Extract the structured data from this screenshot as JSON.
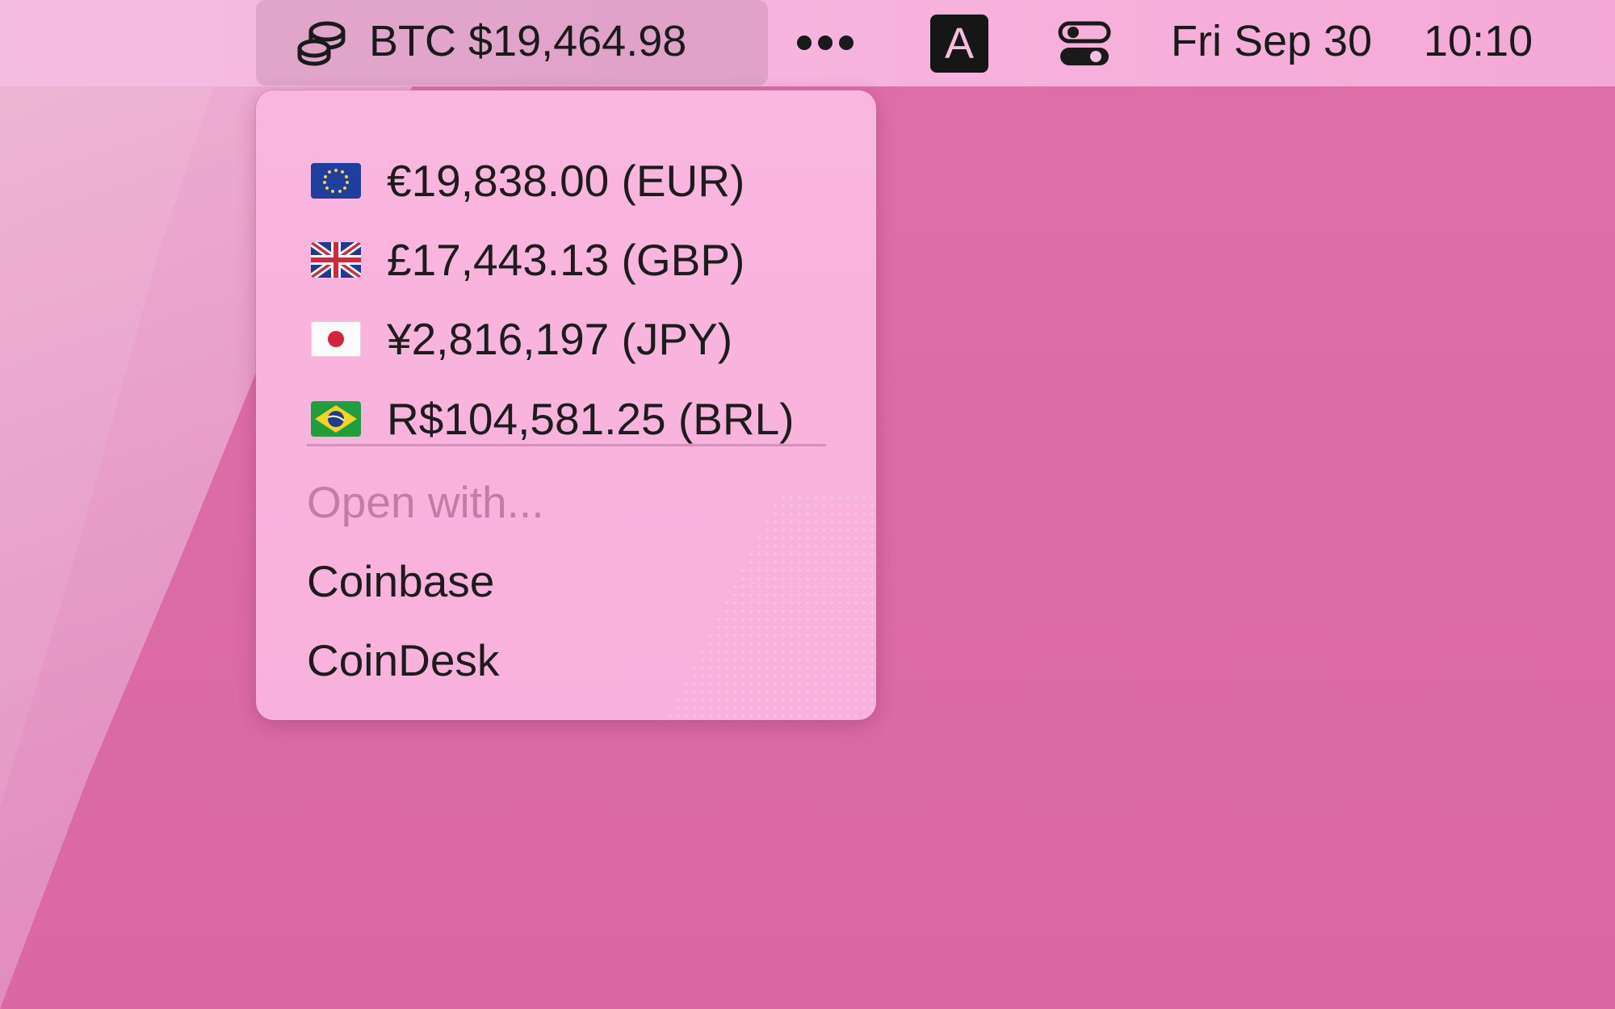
{
  "menubar": {
    "btc_label": "BTC $19,464.98",
    "input_source_label": "A",
    "date": "Fri Sep 30",
    "time": "10:10",
    "icons": {
      "btc": "coins-icon",
      "more": "ellipsis-icon",
      "input_source": "input-source-icon",
      "control_center": "control-center-icon"
    }
  },
  "dropdown": {
    "prices": [
      {
        "flag": "eu-flag-icon",
        "label": "€19,838.00 (EUR)"
      },
      {
        "flag": "uk-flag-icon",
        "label": "£17,443.13 (GBP)"
      },
      {
        "flag": "japan-flag-icon",
        "label": "¥2,816,197 (JPY)"
      },
      {
        "flag": "brazil-flag-icon",
        "label": "R$104,581.25 (BRL)"
      }
    ],
    "open_with_header": "Open with...",
    "open_with_items": [
      "Coinbase",
      "CoinDesk"
    ]
  },
  "colors": {
    "menubar_bg": "#f7b6df",
    "wallpaper": "#d968a3",
    "dropdown_bg": "#f9b6de",
    "text": "#1c1c1c",
    "disabled_text": "#c48aab"
  }
}
